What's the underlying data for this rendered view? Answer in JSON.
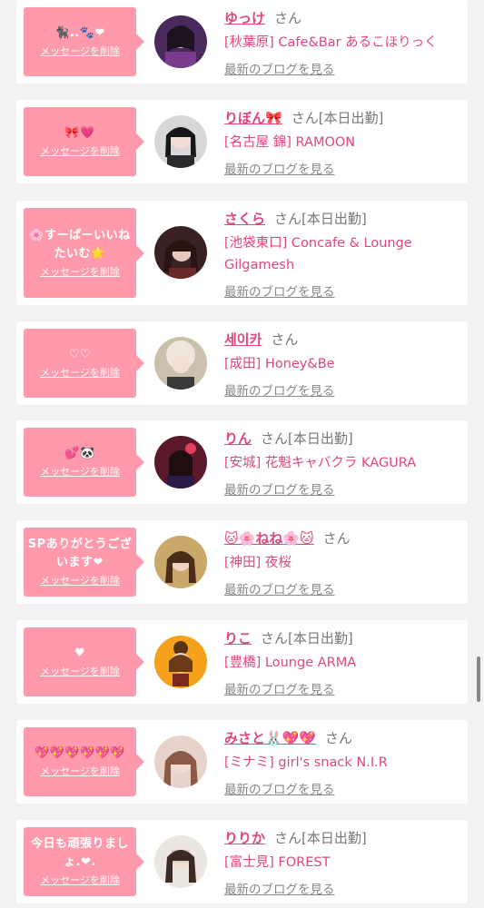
{
  "delete_label": "メッセージを削除",
  "san_label": "さん",
  "blog_label": "最新のブログを見る",
  "colors": {
    "bubble": "#fe9aab",
    "accent": "#e0477a"
  },
  "entries": [
    {
      "message": "🐈‍⬛..🐾❤",
      "name": "ゆっけ",
      "status": "",
      "shop": "[秋葉原] Cafe&Bar あるこほりっく"
    },
    {
      "message": "🎀💗",
      "name": "りぼん🎀",
      "status": "[本日出勤]",
      "shop": "[名古屋 錦] RAMOON"
    },
    {
      "message": "🌸すーぱーいいねたいむ🌟",
      "name": "さくら",
      "status": "[本日出勤]",
      "shop": "[池袋東口] Concafe & Lounge Gilgamesh"
    },
    {
      "message": "♡♡",
      "name": "세이카",
      "status": "",
      "shop": "[成田] Honey&Be"
    },
    {
      "message": "💕🐼",
      "name": "りん",
      "status": "[本日出勤]",
      "shop": "[安城] 花魁キャバクラ KAGURA"
    },
    {
      "message": "SPありがとうございます❤",
      "name": "🐱🌸ねね🌸🐱",
      "status": "",
      "shop": "[神田] 夜桜"
    },
    {
      "message": "♥",
      "name": "りこ",
      "status": "[本日出勤]",
      "shop": "[豊橋] Lounge ARMA"
    },
    {
      "message": "💖💖💖💖💖💖",
      "name": "みさと🐰💖💖",
      "status": "",
      "shop": "[ミナミ] girl's snack N.I.R"
    },
    {
      "message": "今日も頑張りましょ.❤.",
      "name": "りりか",
      "status": "[本日出勤]",
      "shop": "[富士見] FOREST"
    }
  ]
}
